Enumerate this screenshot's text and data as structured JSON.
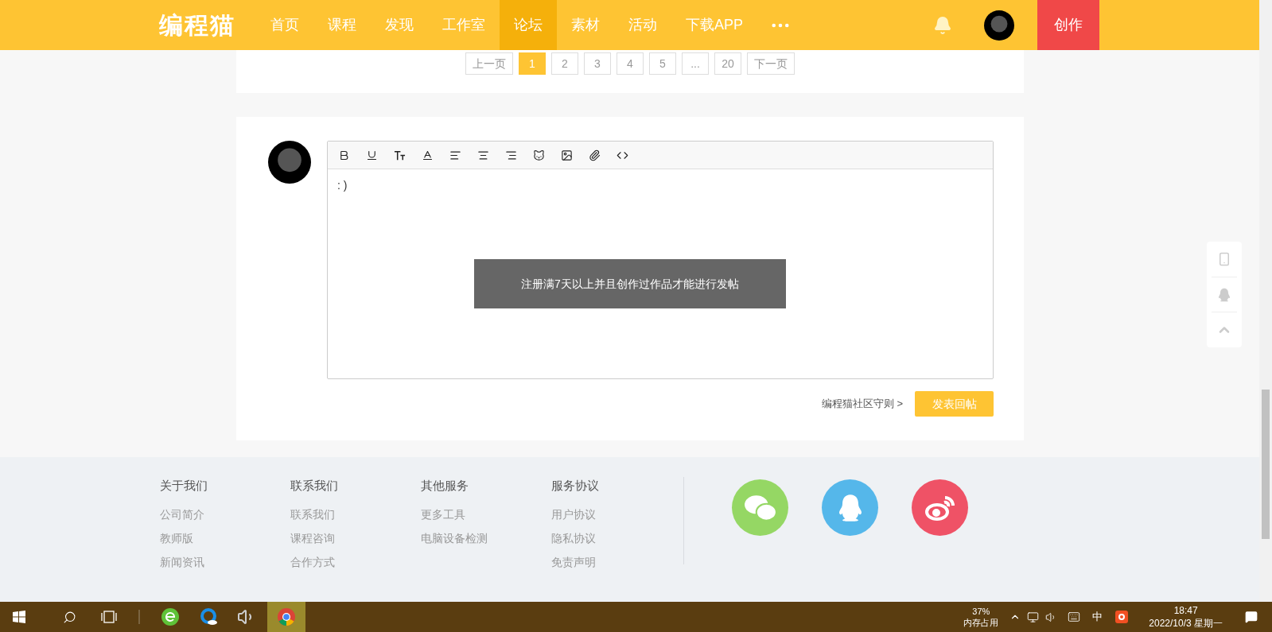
{
  "header": {
    "logo": "编程猫",
    "nav": [
      {
        "label": "首页",
        "selected": false
      },
      {
        "label": "课程",
        "selected": false
      },
      {
        "label": "发现",
        "selected": false
      },
      {
        "label": "工作室",
        "selected": false
      },
      {
        "label": "论坛",
        "selected": true
      },
      {
        "label": "素材",
        "selected": false
      },
      {
        "label": "活动",
        "selected": false
      },
      {
        "label": "下载APP",
        "selected": false
      }
    ],
    "create_button": "创作"
  },
  "pagination": [
    {
      "label": "上一页",
      "selected": false
    },
    {
      "label": "1",
      "selected": true
    },
    {
      "label": "2",
      "selected": false
    },
    {
      "label": "3",
      "selected": false
    },
    {
      "label": "4",
      "selected": false
    },
    {
      "label": "5",
      "selected": false
    },
    {
      "label": "...",
      "selected": false
    },
    {
      "label": "20",
      "selected": false
    },
    {
      "label": "下一页",
      "selected": false
    }
  ],
  "reply": {
    "editor_value": ": )",
    "toast": "注册满7天以上并且创作过作品才能进行发帖",
    "rules_link": "编程猫社区守则 >",
    "submit_button": "发表回帖"
  },
  "footer": {
    "columns": [
      {
        "title": "关于我们",
        "links": [
          "公司简介",
          "教师版",
          "新闻资讯"
        ]
      },
      {
        "title": "联系我们",
        "links": [
          "联系我们",
          "课程咨询",
          "合作方式"
        ]
      },
      {
        "title": "其他服务",
        "links": [
          "更多工具",
          "电脑设备检测"
        ]
      },
      {
        "title": "服务协议",
        "links": [
          "用户协议",
          "隐私协议",
          "免责声明"
        ]
      }
    ]
  },
  "taskbar": {
    "memory_percent": "37%",
    "memory_label": "内存占用",
    "ime": "中",
    "time": "18:47",
    "date": "2022/10/3 星期一"
  }
}
